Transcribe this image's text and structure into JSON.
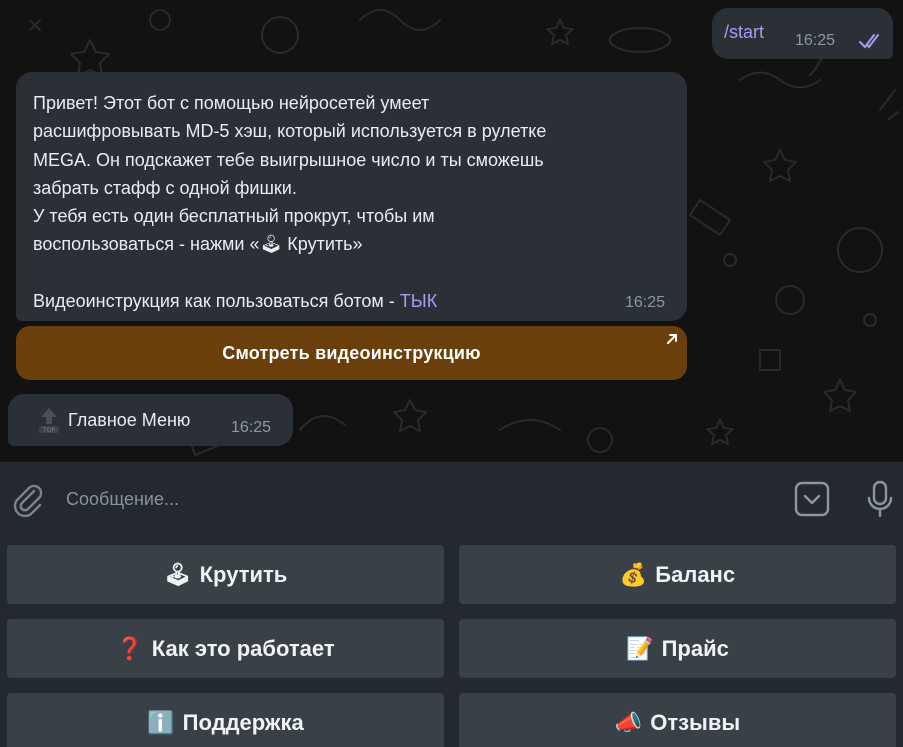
{
  "outgoing": {
    "text": "/start",
    "time": "16:25"
  },
  "bot_message": {
    "text": "Привет! Этот бот с помощью нейросетей умеет\nрасшифровывать MD-5 хэш, который используется в рулетке\nMEGA. Он подскажет тебе выигрышное число и ты сможешь\nзабрать стафф с одной фишки.\nУ тебя есть один бесплатный прокрут, чтобы им\nвоспользоваться - нажми «🕹 Крутить»\n\nВидеоинструкция как пользоваться ботом - ",
    "link": "ТЫК",
    "time": "16:25",
    "inline_button": "Смотреть видеоинструкцию"
  },
  "menu_message": {
    "text": "Главное Меню",
    "time": "16:25"
  },
  "composer": {
    "placeholder": "Сообщение..."
  },
  "keyboard": {
    "buttons": [
      {
        "emoji": "🕹",
        "label": "Крутить"
      },
      {
        "emoji": "💰",
        "label": "Баланс"
      },
      {
        "emoji": "❓",
        "label": "Как это работает"
      },
      {
        "emoji": "📝",
        "label": "Прайс"
      },
      {
        "emoji": "ℹ️",
        "label": "Поддержка"
      },
      {
        "emoji": "📣",
        "label": "Отзывы"
      }
    ]
  },
  "colors": {
    "bubble": "#2b3036",
    "accent_link": "#a99bf1",
    "inline_button": "#6b3f0c",
    "keyboard_button": "#3a4048",
    "panel": "#24292f"
  }
}
